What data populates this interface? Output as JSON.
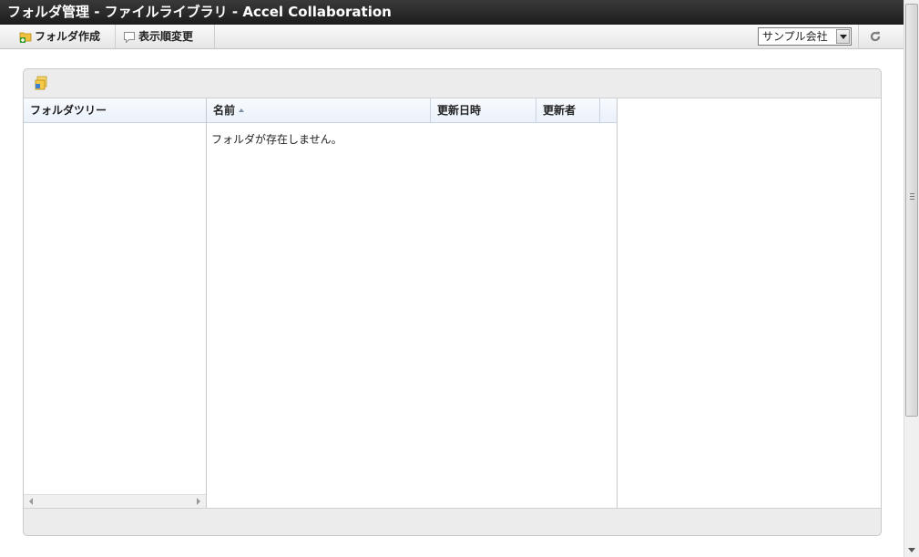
{
  "window": {
    "title": "フォルダ管理 - ファイルライブラリ - Accel Collaboration"
  },
  "toolbar": {
    "create_folder_label": "フォルダ作成",
    "create_folder_icon": "folder-add-icon",
    "reorder_label": "表示順変更",
    "reorder_icon": "reorder-icon",
    "company_select": {
      "selected": "サンプル会社"
    },
    "refresh_icon": "refresh-icon"
  },
  "panel": {
    "top_icon": "folder-properties-icon",
    "tree": {
      "header": "フォルダツリー"
    },
    "list": {
      "columns": [
        {
          "label": "名前",
          "sorted": "ascending"
        },
        {
          "label": "更新日時"
        },
        {
          "label": "更新者"
        }
      ],
      "empty_message": "フォルダが存在しません。"
    }
  },
  "colors": {
    "titlebar": "#2a2a2a",
    "column_header": "#eef4fb",
    "panel_background": "#ececec"
  }
}
